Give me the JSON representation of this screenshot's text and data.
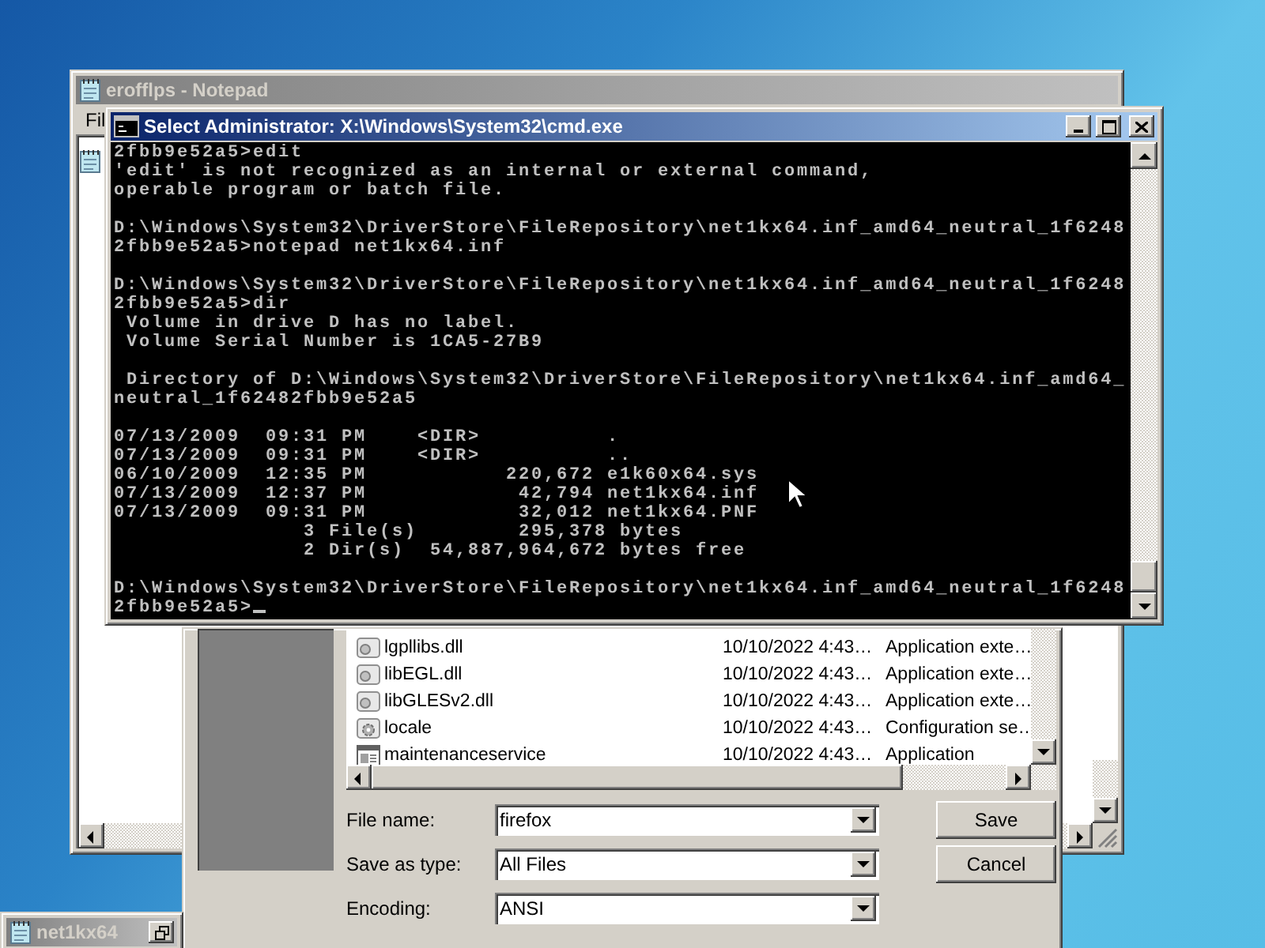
{
  "notepad_window": {
    "title": "erofflps - Notepad",
    "active": false,
    "menu": [
      "Fil"
    ]
  },
  "save_dialog": {
    "files": [
      {
        "name": "lgpllibs.dll",
        "date": "10/10/2022 4:43…",
        "type": "Application exte…",
        "kind": "dll"
      },
      {
        "name": "libEGL.dll",
        "date": "10/10/2022 4:43…",
        "type": "Application exte…",
        "kind": "dll"
      },
      {
        "name": "libGLESv2.dll",
        "date": "10/10/2022 4:43…",
        "type": "Application exte…",
        "kind": "dll"
      },
      {
        "name": "locale",
        "date": "10/10/2022 4:43…",
        "type": "Configuration se…",
        "kind": "settings"
      },
      {
        "name": "maintenanceservice",
        "date": "10/10/2022 4:43…",
        "type": "Application",
        "kind": "app"
      }
    ],
    "fields": [
      {
        "label": "File name:",
        "value": "firefox"
      },
      {
        "label": "Save as type:",
        "value": "All Files"
      },
      {
        "label": "Encoding:",
        "value": "ANSI"
      }
    ],
    "buttons": [
      "Save",
      "Cancel"
    ]
  },
  "cmd_window": {
    "title": "Select Administrator: X:\\Windows\\System32\\cmd.exe",
    "active": true,
    "blocks": [
      [
        "2fbb9e52a5>edit",
        "'edit' is not recognized as an internal or external command,",
        "operable program or batch file."
      ],
      [
        "D:\\Windows\\System32\\DriverStore\\FileRepository\\net1kx64.inf_amd64_neutral_1f6248",
        "2fbb9e52a5>notepad net1kx64.inf"
      ],
      [
        "D:\\Windows\\System32\\DriverStore\\FileRepository\\net1kx64.inf_amd64_neutral_1f6248",
        "2fbb9e52a5>dir",
        " Volume in drive D has no label.",
        " Volume Serial Number is 1CA5-27B9"
      ],
      [
        " Directory of D:\\Windows\\System32\\DriverStore\\FileRepository\\net1kx64.inf_amd64_",
        "neutral_1f62482fbb9e52a5"
      ],
      [
        "07/13/2009  09:31 PM    <DIR>          .",
        "07/13/2009  09:31 PM    <DIR>          ..",
        "06/10/2009  12:35 PM           220,672 e1k60x64.sys",
        "07/13/2009  12:37 PM            42,794 net1kx64.inf",
        "07/13/2009  09:31 PM            32,012 net1kx64.PNF",
        "               3 File(s)        295,378 bytes",
        "               2 Dir(s)  54,887,964,672 bytes free"
      ],
      [
        "D:\\Windows\\System32\\DriverStore\\FileRepository\\net1kx64.inf_amd64_neutral_1f6248",
        "2fbb9e52a5>"
      ]
    ]
  },
  "minimized_window": {
    "title": "net1kx64"
  }
}
